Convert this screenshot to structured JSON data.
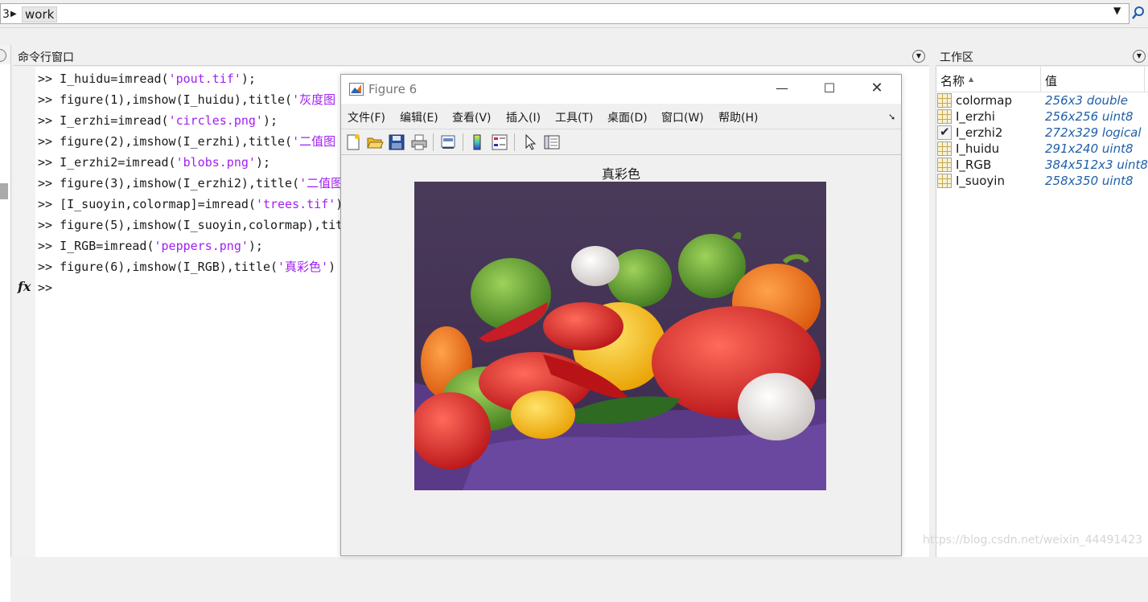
{
  "address_bar": {
    "prefix": "3",
    "crumb": "work"
  },
  "command_window": {
    "title": "命令行窗口",
    "prompt": ">>",
    "lines": [
      {
        "code": "I_huidu=imread(",
        "str": "'pout.tif'",
        "tail": ");"
      },
      {
        "code": "figure(1),imshow(I_huidu),title(",
        "str": "'灰度图",
        "tail": ""
      },
      {
        "code": "I_erzhi=imread(",
        "str": "'circles.png'",
        "tail": ");"
      },
      {
        "code": "figure(2),imshow(I_erzhi),title(",
        "str": "'二值图",
        "tail": ""
      },
      {
        "code": "I_erzhi2=imread(",
        "str": "'blobs.png'",
        "tail": ");"
      },
      {
        "code": "figure(3),imshow(I_erzhi2),title(",
        "str": "'二值图",
        "tail": ""
      },
      {
        "code": "[I_suoyin,colormap]=imread(",
        "str": "'trees.tif'",
        "tail": ")"
      },
      {
        "code": "figure(5),imshow(I_suoyin,colormap),tit",
        "str": "",
        "tail": ""
      },
      {
        "code": "I_RGB=imread(",
        "str": "'peppers.png'",
        "tail": ");"
      },
      {
        "code": "figure(6),imshow(I_RGB),title(",
        "str": "'真彩色'",
        "tail": ")"
      }
    ],
    "fx_label": "fx"
  },
  "workspace": {
    "title": "工作区",
    "col_name": "名称",
    "col_value": "值",
    "variables": [
      {
        "name": "colormap",
        "value": "256x3 double",
        "icon": "matrix-icon"
      },
      {
        "name": "I_erzhi",
        "value": "256x256 uint8",
        "icon": "matrix-icon"
      },
      {
        "name": "I_erzhi2",
        "value": "272x329 logical",
        "icon": "logical-icon"
      },
      {
        "name": "I_huidu",
        "value": "291x240 uint8",
        "icon": "matrix-icon"
      },
      {
        "name": "I_RGB",
        "value": "384x512x3 uint8",
        "icon": "matrix-icon"
      },
      {
        "name": "I_suoyin",
        "value": "258x350 uint8",
        "icon": "matrix-icon"
      }
    ]
  },
  "figure": {
    "title": "Figure 6",
    "menu": [
      "文件(F)",
      "编辑(E)",
      "查看(V)",
      "插入(I)",
      "工具(T)",
      "桌面(D)",
      "窗口(W)",
      "帮助(H)"
    ],
    "axes_title": "真彩色",
    "toolbar": [
      "new-figure-icon",
      "open-file-icon",
      "save-icon",
      "print-icon",
      "link-plot-icon",
      "colorbar-icon",
      "legend-icon",
      "select-pointer-icon",
      "plot-tools-icon"
    ],
    "image_description_colors": {
      "background": "#4a2f5c",
      "cloth": "#5a3a86"
    }
  },
  "watermark": "https://blog.csdn.net/weixin_44491423"
}
